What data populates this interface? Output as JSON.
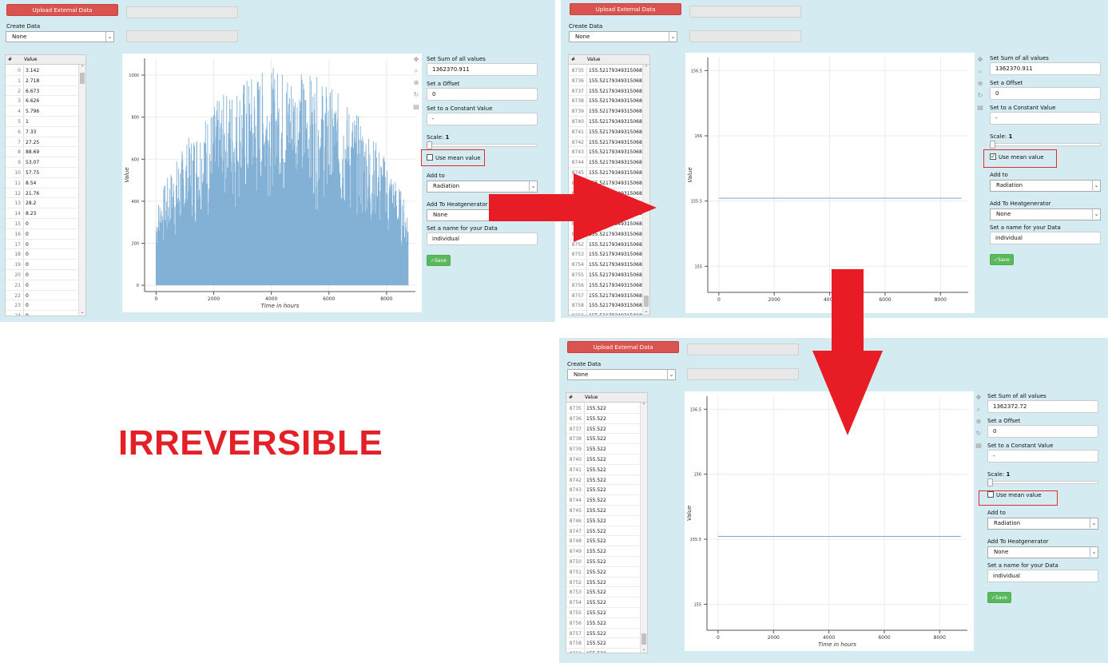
{
  "caption": "IRREVERSIBLE",
  "colors": {
    "panel_bg": "#d4ebf1",
    "upload_btn": "#d9534f",
    "save_btn": "#5cb85c",
    "plot_line": "#76a8d0",
    "highlight": "#e32b2b",
    "arrow": "#e81c24"
  },
  "panels": [
    {
      "upload_label": "Upload External Data",
      "create_data_label": "Create Data",
      "create_data_value": "None",
      "table": {
        "headers": [
          "#",
          "Value"
        ],
        "rows": [
          [
            "0",
            "3.142"
          ],
          [
            "1",
            "2.718"
          ],
          [
            "2",
            "6.673"
          ],
          [
            "3",
            "6.626"
          ],
          [
            "4",
            "5.796"
          ],
          [
            "5",
            "1"
          ],
          [
            "6",
            "7.33"
          ],
          [
            "7",
            "27.25"
          ],
          [
            "8",
            "88.69"
          ],
          [
            "9",
            "53.07"
          ],
          [
            "10",
            "57.75"
          ],
          [
            "11",
            "8.54"
          ],
          [
            "12",
            "21.76"
          ],
          [
            "13",
            "28.2"
          ],
          [
            "14",
            "8.23"
          ],
          [
            "15",
            "0"
          ],
          [
            "16",
            "0"
          ],
          [
            "17",
            "0"
          ],
          [
            "18",
            "0"
          ],
          [
            "19",
            "0"
          ],
          [
            "20",
            "0"
          ],
          [
            "21",
            "0"
          ],
          [
            "22",
            "0"
          ],
          [
            "23",
            "0"
          ],
          [
            "24",
            "0"
          ]
        ]
      },
      "plot": {
        "xlabel": "Time in hours",
        "ylabel": "Value",
        "xticks": [
          "0",
          "2000",
          "4000",
          "6000",
          "8000"
        ],
        "yticks": [
          "0",
          "200",
          "400",
          "600",
          "800",
          "1000"
        ]
      },
      "controls": {
        "sum_label": "Set Sum of all values",
        "sum_value": "1362370.911",
        "offset_label": "Set a Offset",
        "offset_value": "0",
        "constant_label": "Set to a Constant Value",
        "constant_value": "-",
        "scale_label": "Scale:",
        "scale_value": "1",
        "mean_label": "Use mean value",
        "mean_checked": "",
        "addto_label": "Add to",
        "addto_value": "Radiation",
        "heatgen_label": "Add To Heatgenerator",
        "heatgen_value": "None",
        "name_label": "Set a name for your Data",
        "name_value": "individual",
        "save_label": "✓Save"
      }
    },
    {
      "upload_label": "Upload External Data",
      "create_data_label": "Create Data",
      "create_data_value": "None",
      "table": {
        "headers": [
          "#",
          "Value"
        ],
        "rows": [
          [
            "8735",
            "155.52179349315068"
          ],
          [
            "8736",
            "155.52179349315068"
          ],
          [
            "8737",
            "155.52179349315068"
          ],
          [
            "8738",
            "155.52179349315068"
          ],
          [
            "8739",
            "155.52179349315068"
          ],
          [
            "8740",
            "155.52179349315068"
          ],
          [
            "8741",
            "155.52179349315068"
          ],
          [
            "8742",
            "155.52179349315068"
          ],
          [
            "8743",
            "155.52179349315068"
          ],
          [
            "8744",
            "155.52179349315068"
          ],
          [
            "8745",
            "155.52179349315068"
          ],
          [
            "8746",
            "155.52179349315068"
          ],
          [
            "8747",
            "155.52179349315068"
          ],
          [
            "8748",
            "155.52179349315068"
          ],
          [
            "8749",
            "155.52179349315068"
          ],
          [
            "8750",
            "155.52179349315068"
          ],
          [
            "8751",
            "155.52179349315068"
          ],
          [
            "8752",
            "155.52179349315068"
          ],
          [
            "8753",
            "155.52179349315068"
          ],
          [
            "8754",
            "155.52179349315068"
          ],
          [
            "8755",
            "155.52179349315068"
          ],
          [
            "8756",
            "155.52179349315068"
          ],
          [
            "8757",
            "155.52179349315068"
          ],
          [
            "8758",
            "155.52179349315068"
          ],
          [
            "8759",
            "155.52179349315068"
          ]
        ]
      },
      "plot": {
        "xlabel": "",
        "ylabel": "Value",
        "xticks": [
          "0",
          "2000",
          "4000",
          "6000",
          "8000"
        ],
        "yticks": [
          "155",
          "155.5",
          "156",
          "156.5"
        ]
      },
      "controls": {
        "sum_label": "Set Sum of all values",
        "sum_value": "1362370.911",
        "offset_label": "Set a Offset",
        "offset_value": "0",
        "constant_label": "Set to a Constant Value",
        "constant_value": "-",
        "scale_label": "Scale:",
        "scale_value": "1",
        "mean_label": "Use mean value",
        "mean_checked": "✓",
        "addto_label": "Add to",
        "addto_value": "Radiation",
        "heatgen_label": "Add To Heatgenerator",
        "heatgen_value": "None",
        "name_label": "Set a name for your Data",
        "name_value": "individual",
        "save_label": "✓Save"
      }
    },
    {
      "upload_label": "Upload External Data",
      "create_data_label": "Create Data",
      "create_data_value": "None",
      "table": {
        "headers": [
          "#",
          "Value"
        ],
        "rows": [
          [
            "8735",
            "155.522"
          ],
          [
            "8736",
            "155.522"
          ],
          [
            "8737",
            "155.522"
          ],
          [
            "8738",
            "155.522"
          ],
          [
            "8739",
            "155.522"
          ],
          [
            "8740",
            "155.522"
          ],
          [
            "8741",
            "155.522"
          ],
          [
            "8742",
            "155.522"
          ],
          [
            "8743",
            "155.522"
          ],
          [
            "8744",
            "155.522"
          ],
          [
            "8745",
            "155.522"
          ],
          [
            "8746",
            "155.522"
          ],
          [
            "8747",
            "155.522"
          ],
          [
            "8748",
            "155.522"
          ],
          [
            "8749",
            "155.522"
          ],
          [
            "8750",
            "155.522"
          ],
          [
            "8751",
            "155.522"
          ],
          [
            "8752",
            "155.522"
          ],
          [
            "8753",
            "155.522"
          ],
          [
            "8754",
            "155.522"
          ],
          [
            "8755",
            "155.522"
          ],
          [
            "8756",
            "155.522"
          ],
          [
            "8757",
            "155.522"
          ],
          [
            "8758",
            "155.522"
          ],
          [
            "8759",
            "155.522"
          ]
        ]
      },
      "plot": {
        "xlabel": "Time in hours",
        "ylabel": "Value",
        "xticks": [
          "0",
          "2000",
          "4000",
          "6000",
          "8000"
        ],
        "yticks": [
          "155",
          "155.5",
          "156",
          "156.5"
        ]
      },
      "controls": {
        "sum_label": "Set Sum of all values",
        "sum_value": "1362372.72",
        "offset_label": "Set a Offset",
        "offset_value": "0",
        "constant_label": "Set to a Constant Value",
        "constant_value": "-",
        "scale_label": "Scale:",
        "scale_value": "1",
        "mean_label": "Use mean value",
        "mean_checked": "",
        "addto_label": "Add to",
        "addto_value": "Radiation",
        "heatgen_label": "Add To Heatgenerator",
        "heatgen_value": "None",
        "name_label": "Set a name for your Data",
        "name_value": "individual",
        "save_label": "✓Save"
      }
    }
  ]
}
